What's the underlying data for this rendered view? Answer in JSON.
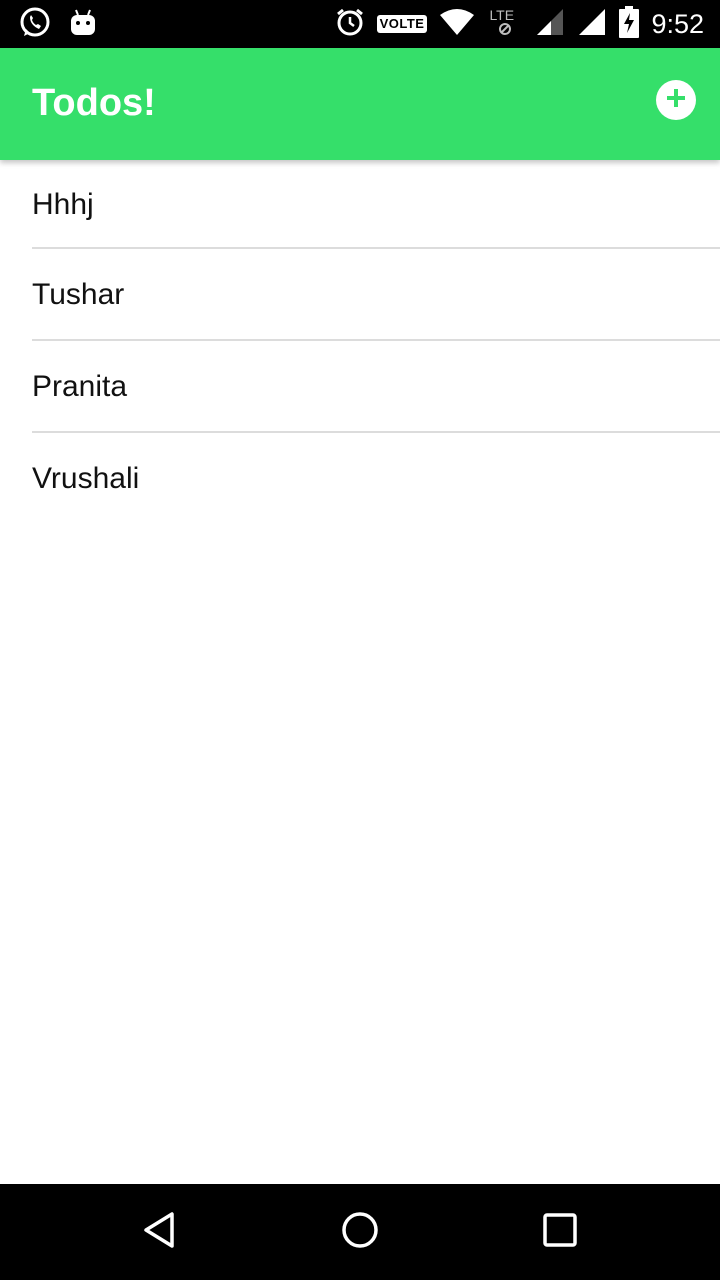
{
  "status_bar": {
    "time": "9:52",
    "volte_label": "VOLTE",
    "lte_label": "LTE",
    "icons": [
      "whatsapp-icon",
      "android-icon",
      "alarm-icon",
      "volte-badge",
      "wifi-icon",
      "lte-icon",
      "signal-icon",
      "signal-icon",
      "battery-charging-icon"
    ]
  },
  "app_bar": {
    "title": "Todos!",
    "add_icon": "add-circle-icon",
    "color": "#35DF6A"
  },
  "todos": [
    {
      "label": "Hhhj"
    },
    {
      "label": "Tushar"
    },
    {
      "label": "Pranita"
    },
    {
      "label": "Vrushali"
    }
  ],
  "nav_bar": {
    "icons": [
      "back-icon",
      "home-icon",
      "recents-icon"
    ]
  }
}
